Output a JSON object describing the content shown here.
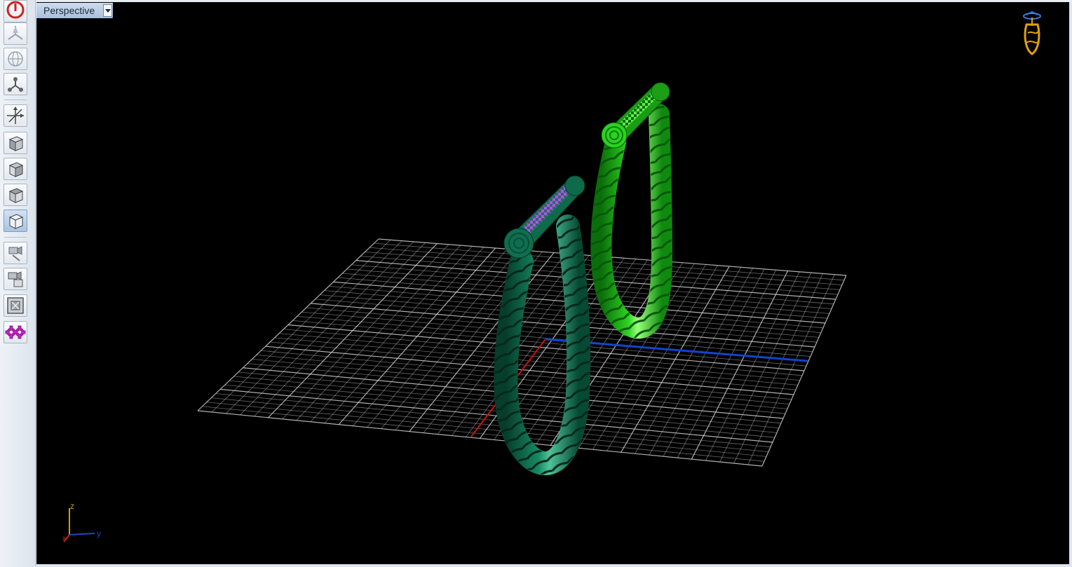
{
  "viewport": {
    "label": "Perspective",
    "projection": "perspective",
    "background": "#000000"
  },
  "toolbar": {
    "buttons": [
      {
        "name": "power-icon",
        "color": "#cc2222"
      },
      {
        "name": "pan-tripod-icon"
      },
      {
        "name": "orbit-globe-icon"
      },
      {
        "name": "node-connect-icon"
      },
      {
        "name": "move-axes-icon"
      },
      {
        "name": "cube-view-1-icon"
      },
      {
        "name": "cube-view-2-icon"
      },
      {
        "name": "cube-view-3-icon"
      },
      {
        "name": "cube-view-4-icon",
        "active": true
      },
      {
        "name": "camera-edit-icon"
      },
      {
        "name": "camera-tools-icon"
      },
      {
        "name": "fit-frame-icon"
      },
      {
        "name": "settings-gear-icon",
        "color": "#cc22cc"
      }
    ]
  },
  "axis_indicator": {
    "z": "z",
    "y": "y",
    "x": "x",
    "colors": {
      "x": "#cc2222",
      "y": "#2244cc",
      "z": "#c8a020"
    }
  },
  "scene": {
    "grid_color": "#cfcfcf",
    "x_axis_color": "#cc1111",
    "y_axis_color": "#1144cc",
    "objects": [
      {
        "name": "twisted-rope-handle-dark",
        "color": "#0f6e4f"
      },
      {
        "name": "twisted-rope-handle-bright",
        "color": "#2bd41f"
      }
    ]
  }
}
